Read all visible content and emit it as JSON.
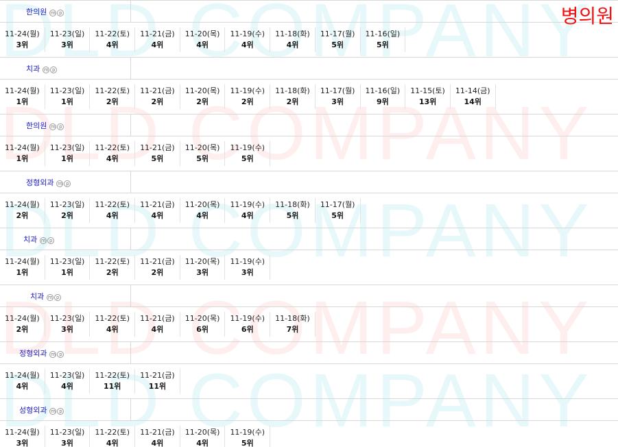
{
  "brand": "병의원",
  "watermark": "DLD COMPANY",
  "badges": [
    "m",
    "p"
  ],
  "sections": [
    {
      "label": "한의원",
      "cells": [
        {
          "date": "11-24(월)",
          "rank": "3위"
        },
        {
          "date": "11-23(일)",
          "rank": "3위"
        },
        {
          "date": "11-22(토)",
          "rank": "4위"
        },
        {
          "date": "11-21(금)",
          "rank": "4위"
        },
        {
          "date": "11-20(목)",
          "rank": "4위"
        },
        {
          "date": "11-19(수)",
          "rank": "4위"
        },
        {
          "date": "11-18(화)",
          "rank": "4위"
        },
        {
          "date": "11-17(월)",
          "rank": "5위"
        },
        {
          "date": "11-16(일)",
          "rank": "5위"
        }
      ]
    },
    {
      "label": "치과",
      "cells": [
        {
          "date": "11-24(월)",
          "rank": "1위"
        },
        {
          "date": "11-23(일)",
          "rank": "1위"
        },
        {
          "date": "11-22(토)",
          "rank": "2위"
        },
        {
          "date": "11-21(금)",
          "rank": "2위"
        },
        {
          "date": "11-20(목)",
          "rank": "2위"
        },
        {
          "date": "11-19(수)",
          "rank": "2위"
        },
        {
          "date": "11-18(화)",
          "rank": "2위"
        },
        {
          "date": "11-17(월)",
          "rank": "3위"
        },
        {
          "date": "11-16(일)",
          "rank": "9위"
        },
        {
          "date": "11-15(토)",
          "rank": "13위"
        },
        {
          "date": "11-14(금)",
          "rank": "14위"
        }
      ]
    },
    {
      "label": "한의원",
      "cells": [
        {
          "date": "11-24(월)",
          "rank": "1위"
        },
        {
          "date": "11-23(일)",
          "rank": "1위"
        },
        {
          "date": "11-22(토)",
          "rank": "4위"
        },
        {
          "date": "11-21(금)",
          "rank": "5위"
        },
        {
          "date": "11-20(목)",
          "rank": "5위"
        },
        {
          "date": "11-19(수)",
          "rank": "5위"
        }
      ]
    },
    {
      "label": "정형외과",
      "cells": [
        {
          "date": "11-24(월)",
          "rank": "2위"
        },
        {
          "date": "11-23(일)",
          "rank": "2위"
        },
        {
          "date": "11-22(토)",
          "rank": "4위"
        },
        {
          "date": "11-21(금)",
          "rank": "4위"
        },
        {
          "date": "11-20(목)",
          "rank": "4위"
        },
        {
          "date": "11-19(수)",
          "rank": "4위"
        },
        {
          "date": "11-18(화)",
          "rank": "5위"
        },
        {
          "date": "11-17(월)",
          "rank": "5위"
        }
      ]
    },
    {
      "label": "치과",
      "cells": [
        {
          "date": "11-24(월)",
          "rank": "1위"
        },
        {
          "date": "11-23(일)",
          "rank": "1위"
        },
        {
          "date": "11-22(토)",
          "rank": "2위"
        },
        {
          "date": "11-21(금)",
          "rank": "2위"
        },
        {
          "date": "11-20(목)",
          "rank": "3위"
        },
        {
          "date": "11-19(수)",
          "rank": "3위"
        }
      ]
    },
    {
      "label": "치과",
      "cells": [
        {
          "date": "11-24(월)",
          "rank": "2위"
        },
        {
          "date": "11-23(일)",
          "rank": "3위"
        },
        {
          "date": "11-22(토)",
          "rank": "4위"
        },
        {
          "date": "11-21(금)",
          "rank": "4위"
        },
        {
          "date": "11-20(목)",
          "rank": "6위"
        },
        {
          "date": "11-19(수)",
          "rank": "6위"
        },
        {
          "date": "11-18(화)",
          "rank": "7위"
        }
      ]
    },
    {
      "label": "정형외과",
      "cells": [
        {
          "date": "11-24(월)",
          "rank": "4위"
        },
        {
          "date": "11-23(일)",
          "rank": "4위"
        },
        {
          "date": "11-22(토)",
          "rank": "11위"
        },
        {
          "date": "11-21(금)",
          "rank": "11위"
        }
      ]
    },
    {
      "label": "성형외과",
      "cells": [
        {
          "date": "11-24(월)",
          "rank": "3위"
        },
        {
          "date": "11-23(일)",
          "rank": "3위"
        },
        {
          "date": "11-22(토)",
          "rank": "4위"
        },
        {
          "date": "11-21(금)",
          "rank": "4위"
        },
        {
          "date": "11-20(목)",
          "rank": "4위"
        },
        {
          "date": "11-19(수)",
          "rank": "5위"
        }
      ]
    }
  ]
}
